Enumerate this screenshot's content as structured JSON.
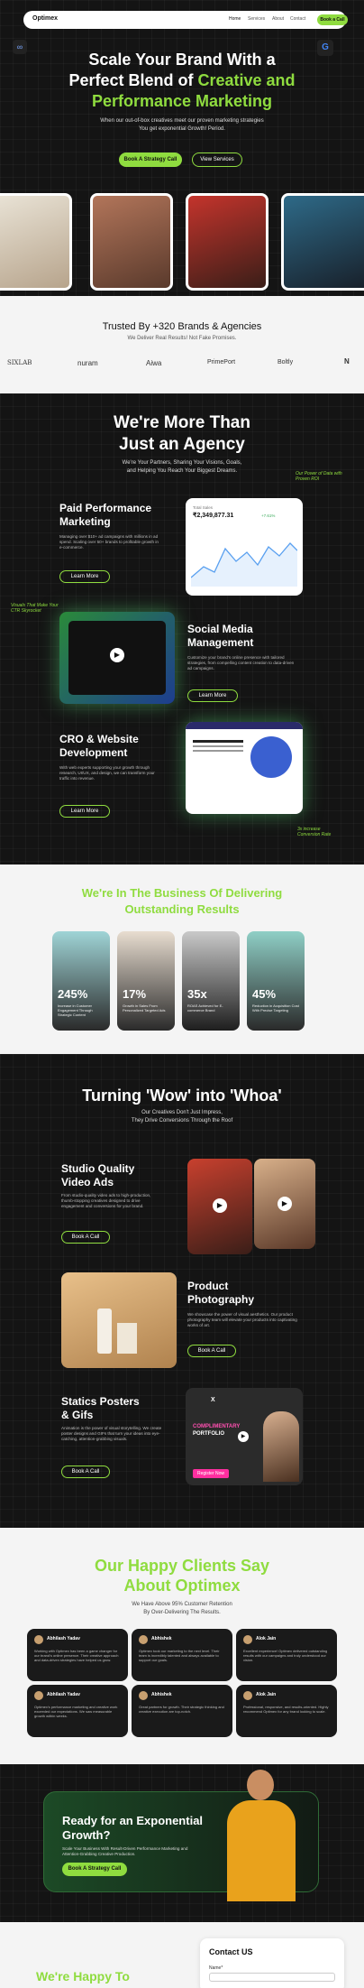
{
  "nav": {
    "logo": "Optimex",
    "links": [
      "Home",
      "Services",
      "About",
      "Contact"
    ],
    "cta": "Book a Call"
  },
  "hero": {
    "title_line1": "Scale Your Brand With a",
    "title_line2_pre": "Perfect Blend of ",
    "title_line2_green": "Creative and",
    "title_line3_green": "Performance Marketing",
    "sub1": "When our out-of-box creatives meet our proven marketing strategies",
    "sub2": "You get exponential Growth! Period.",
    "btn_primary": "Book A Strategy Call",
    "btn_secondary": "View Services"
  },
  "trusted": {
    "title": "Trusted By +320 Brands & Agencies",
    "sub": "We Deliver Real Results! Not Fake Promises.",
    "logos": [
      "SIXLAB",
      "nuram",
      "Aiwa",
      "PrimePort",
      "Boltly",
      "N"
    ]
  },
  "agency": {
    "title1": "We're More Than",
    "title2": "Just an Agency",
    "sub1": "We're Your Partners, Sharing Your Visions, Goals,",
    "sub2": "and Helping You Reach Your Biggest Dreams.",
    "note1": "Our Power of Data with Proven ROI",
    "note2": "Visuals That Make Your CTR Skyrocket",
    "note3": "3x increase Conversion Rate",
    "services": [
      {
        "title1": "Paid Performance",
        "title2": "Marketing",
        "desc": "Managing over $10+ ad campaigns with millions in ad spend. Scaling over 50+ brands to profitable growth in e-commerce.",
        "btn": "Learn More"
      },
      {
        "title1": "Social Media",
        "title2": "Management",
        "desc": "Customize your brand's online presence with tailored strategies, from compelling content creation to data-driven ad campaigns.",
        "btn": "Learn More"
      },
      {
        "title1": "CRO &  Website",
        "title2": "Development",
        "desc": "With web experts supporting your growth through research, UI/UX, and design, we can transform your traffic into revenue.",
        "btn": "Learn More"
      }
    ],
    "dash_label": "Total Sales",
    "dash_value": "₹2,349,877.31",
    "dash_delta": "+7.61%"
  },
  "results": {
    "title1": "We're In The Business Of Delivering",
    "title2": "Outstanding Results",
    "stats": [
      {
        "value": "245%",
        "desc": "Increase in Customer Engagement Through Strategic Content"
      },
      {
        "value": "17%",
        "desc": "Growth in Sales From Personalized Targeted Ads"
      },
      {
        "value": "35x",
        "desc": "ROAS Achieved for E-commerce Brand"
      },
      {
        "value": "45%",
        "desc": "Reduction in Acquisition Cost With Precise Targeting"
      }
    ]
  },
  "wow": {
    "title": "Turning 'Wow' into 'Whoa'",
    "sub1": "Our Creatives Don't Just Impress,",
    "sub2": "They Drive Conversions Through the Roof",
    "items": [
      {
        "title1": "Studio Quality",
        "title2": "Video Ads",
        "desc": "From studio-quality video ads to high-production, thumb-stopping creatives designed to drive engagement and conversions for your brand.",
        "btn": "Book A Call"
      },
      {
        "title1": "Product",
        "title2": "Photography",
        "desc": "We showcase the power of visual aesthetics. Our product photography team will elevate your products into captivating works of art.",
        "btn": "Book A Call"
      },
      {
        "title1": "Statics Posters",
        "title2": "& Gifs",
        "desc": "Animation is the power of visual storytelling. We create poster designs and GIFs that turn your ideas into eye-catching, attention-grabbing visuals.",
        "btn": "Book A Call"
      }
    ],
    "poster_x": "X",
    "poster_tag": "COMPLIMENTARY",
    "poster_line": "PORTFOLIO",
    "poster_cta": "Register Now"
  },
  "clients": {
    "title1": "Our Happy Clients Say",
    "title2": "About Optimex",
    "sub1": "We Have Above 95% Customer Retention",
    "sub2": "By Over-Delivering The Results.",
    "reviews": [
      {
        "name": "Abhilash Yadav",
        "text": "Working with Optimex has been a game changer for our brand's online presence. Their creative approach and data-driven strategies have helped us grow."
      },
      {
        "name": "Abhishek",
        "text": "Optimex took our marketing to the next level. Their team is incredibly talented and always available to support our goals."
      },
      {
        "name": "Alok Jain",
        "text": "Excellent experience! Optimex delivered outstanding results with our campaigns and truly understood our vision."
      },
      {
        "name": "Abhilash Yadav",
        "text": "Optimex's performance marketing and creative work exceeded our expectations. We saw measurable growth within weeks."
      },
      {
        "name": "Abhishek",
        "text": "Great partners for growth. Their strategic thinking and creative execution are top-notch."
      },
      {
        "name": "Alok Jain",
        "text": "Professional, responsive, and results-oriented. Highly recommend Optimex for any brand looking to scale."
      }
    ]
  },
  "cta": {
    "title1": "Ready for an Exponential",
    "title2": "Growth?",
    "desc": "Scale Your Business With Result-Driven Performance Marketing and Attention-Grabbing Creative Production.",
    "btn": "Book A Strategy Call"
  },
  "footer": {
    "happy": "We're Happy To",
    "contact_title": "Contact US",
    "name_label": "Name*"
  },
  "colors": {
    "accent": "#8fdc3f",
    "dark": "#141414"
  }
}
